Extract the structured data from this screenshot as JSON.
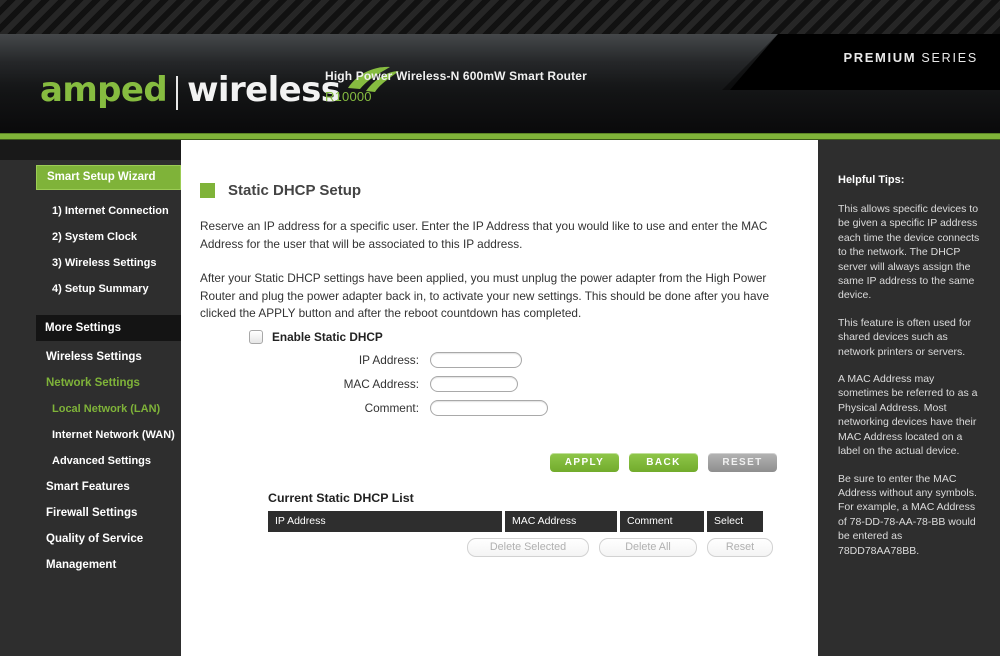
{
  "header": {
    "logo_amped": "amped",
    "logo_wireless": "wireless",
    "model_name": "High Power Wireless-N 600mW Smart Router",
    "model_number": "R10000",
    "premium": "PREMIUM",
    "series": "SERIES",
    "accent_green": "#7fb339",
    "dark_bg": "#2e2e2e"
  },
  "sidebar": {
    "items": [
      {
        "label": "Smart Setup Wizard",
        "style": "active"
      },
      {
        "label": "1) Internet Connection",
        "style": "sub"
      },
      {
        "label": "2) System Clock",
        "style": "sub"
      },
      {
        "label": "3) Wireless Settings",
        "style": "sub"
      },
      {
        "label": "4) Setup Summary",
        "style": "sub"
      },
      {
        "label": "More Settings",
        "style": "section"
      },
      {
        "label": "Wireless Settings",
        "style": "normal"
      },
      {
        "label": "Network Settings",
        "style": "green"
      },
      {
        "label": "Local Network (LAN)",
        "style": "green-sub"
      },
      {
        "label": "Internet Network (WAN)",
        "style": "sub"
      },
      {
        "label": "Advanced Settings",
        "style": "sub"
      },
      {
        "label": "Smart Features",
        "style": "normal"
      },
      {
        "label": "Firewall Settings",
        "style": "normal"
      },
      {
        "label": "Quality of Service",
        "style": "normal"
      },
      {
        "label": "Management",
        "style": "normal"
      }
    ]
  },
  "main": {
    "title": "Static DHCP Setup",
    "paragraph1": "Reserve an IP address for a specific user. Enter the IP Address that you would like to use and enter the MAC Address for the user that will be associated to this IP address.",
    "paragraph2": "After your Static DHCP settings have been applied, you must unplug the power adapter from the High Power Router and plug the power adapter back in, to activate your new settings. This should be done after you have clicked the APPLY button and after the reboot countdown has completed.",
    "form": {
      "enable_label": "Enable Static DHCP",
      "enable_checked": false,
      "ip_label": "IP Address:",
      "ip_value": "",
      "mac_label": "MAC Address:",
      "mac_value": "",
      "comment_label": "Comment:",
      "comment_value": ""
    },
    "buttons": {
      "apply": "APPLY",
      "back": "BACK",
      "reset": "RESET"
    },
    "list": {
      "heading": "Current Static DHCP List",
      "columns": [
        "IP Address",
        "MAC Address",
        "Comment",
        "Select"
      ],
      "rows": [],
      "delete_selected": "Delete Selected",
      "delete_all": "Delete All",
      "reset": "Reset"
    }
  },
  "tips": {
    "heading": "Helpful Tips:",
    "paragraphs": [
      "This allows specific devices to be given a specific IP address each time the device connects to the network.  The DHCP server will always assign the same IP address to the same device.",
      "This feature is often used for shared devices such as network printers or servers.",
      "A MAC Address may sometimes be referred to as a Physical Address.  Most networking devices have their MAC Address located on a label on the actual device.",
      "Be sure to enter the MAC Address without any symbols.  For example, a MAC Address of 78-DD-78-AA-78-BB  would be entered as 78DD78AA78BB."
    ]
  }
}
